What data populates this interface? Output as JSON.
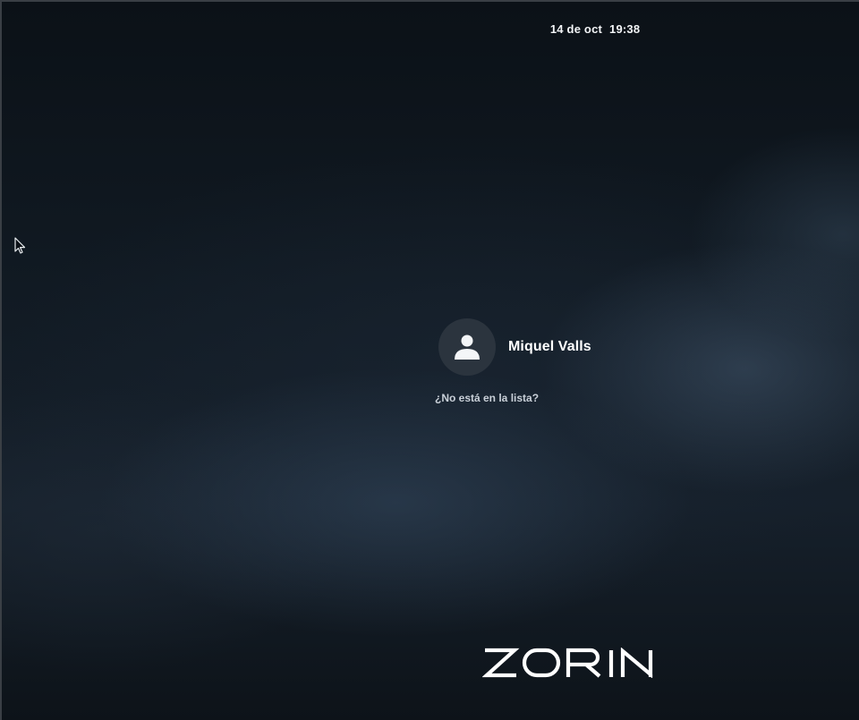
{
  "top_bar": {
    "date": "14 de oct",
    "time": "19:38"
  },
  "login": {
    "user_name": "Miquel Valls",
    "not_listed_link": "¿No está en la lista?"
  },
  "branding": {
    "logo_text": "ZORIN"
  },
  "icons": {
    "avatar": "user-avatar-icon",
    "cursor": "mouse-pointer-icon"
  },
  "colors": {
    "background": "#0b1016",
    "avatar_bg": "#2b343e",
    "text": "#ffffff",
    "link_text": "#c9d0d8"
  }
}
